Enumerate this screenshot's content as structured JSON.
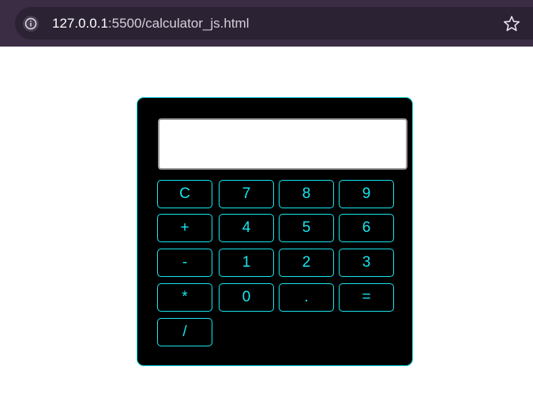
{
  "browser": {
    "url_host": "127.0.0.1",
    "url_rest": ":5500/calculator_js.html"
  },
  "calculator": {
    "display_value": "",
    "accent_color": "#18e6ee",
    "keys": {
      "row1": [
        "C",
        "7",
        "8",
        "9"
      ],
      "row2": [
        "+",
        "4",
        "5",
        "6"
      ],
      "row3": [
        "-",
        "1",
        "2",
        "3"
      ],
      "row4": [
        "*",
        "0",
        ".",
        "="
      ],
      "row5": [
        "/"
      ]
    }
  }
}
